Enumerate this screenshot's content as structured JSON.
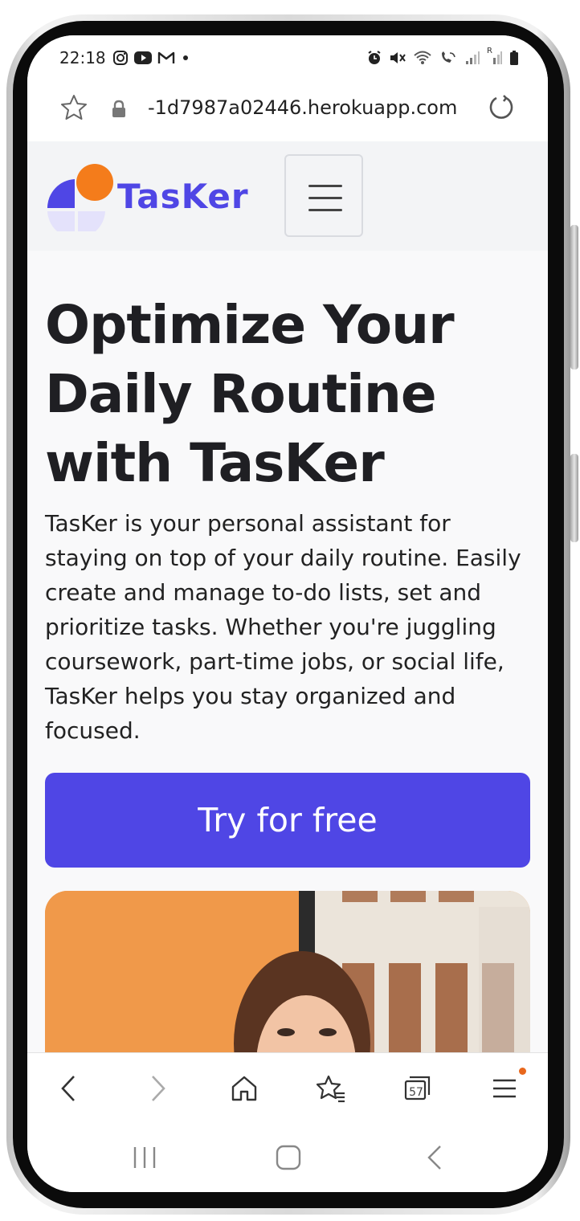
{
  "status_bar": {
    "time": "22:18",
    "left_icons": [
      "instagram-icon",
      "youtube-icon",
      "gmail-icon",
      "dot-icon"
    ],
    "right_icons": [
      "alarm-icon",
      "mute-icon",
      "wifi-icon",
      "wifi-calling-icon",
      "signal-icon",
      "signal-roaming-icon",
      "battery-icon"
    ],
    "roaming_label": "R"
  },
  "browser": {
    "url": "-1d7987a02446.herokuapp.com",
    "tab_count": "57",
    "colors": {
      "notification_dot": "#e8671c"
    }
  },
  "site": {
    "brand": "TasKer",
    "colors": {
      "accent": "#4f46e5",
      "logo_orange": "#f47c1b",
      "logo_light": "#e0ddfb",
      "text": "#1f1f23"
    },
    "hero": {
      "title": "Optimize Your Daily Routine with TasKer",
      "description": "TasKer is your personal assistant for staying on top of your daily routine. Easily create and manage to-do lists, set and prioritize tasks. Whether you're juggling coursework, part-time jobs, or social life, TasKer helps you stay organized and focused.",
      "cta_label": "Try for free"
    }
  }
}
